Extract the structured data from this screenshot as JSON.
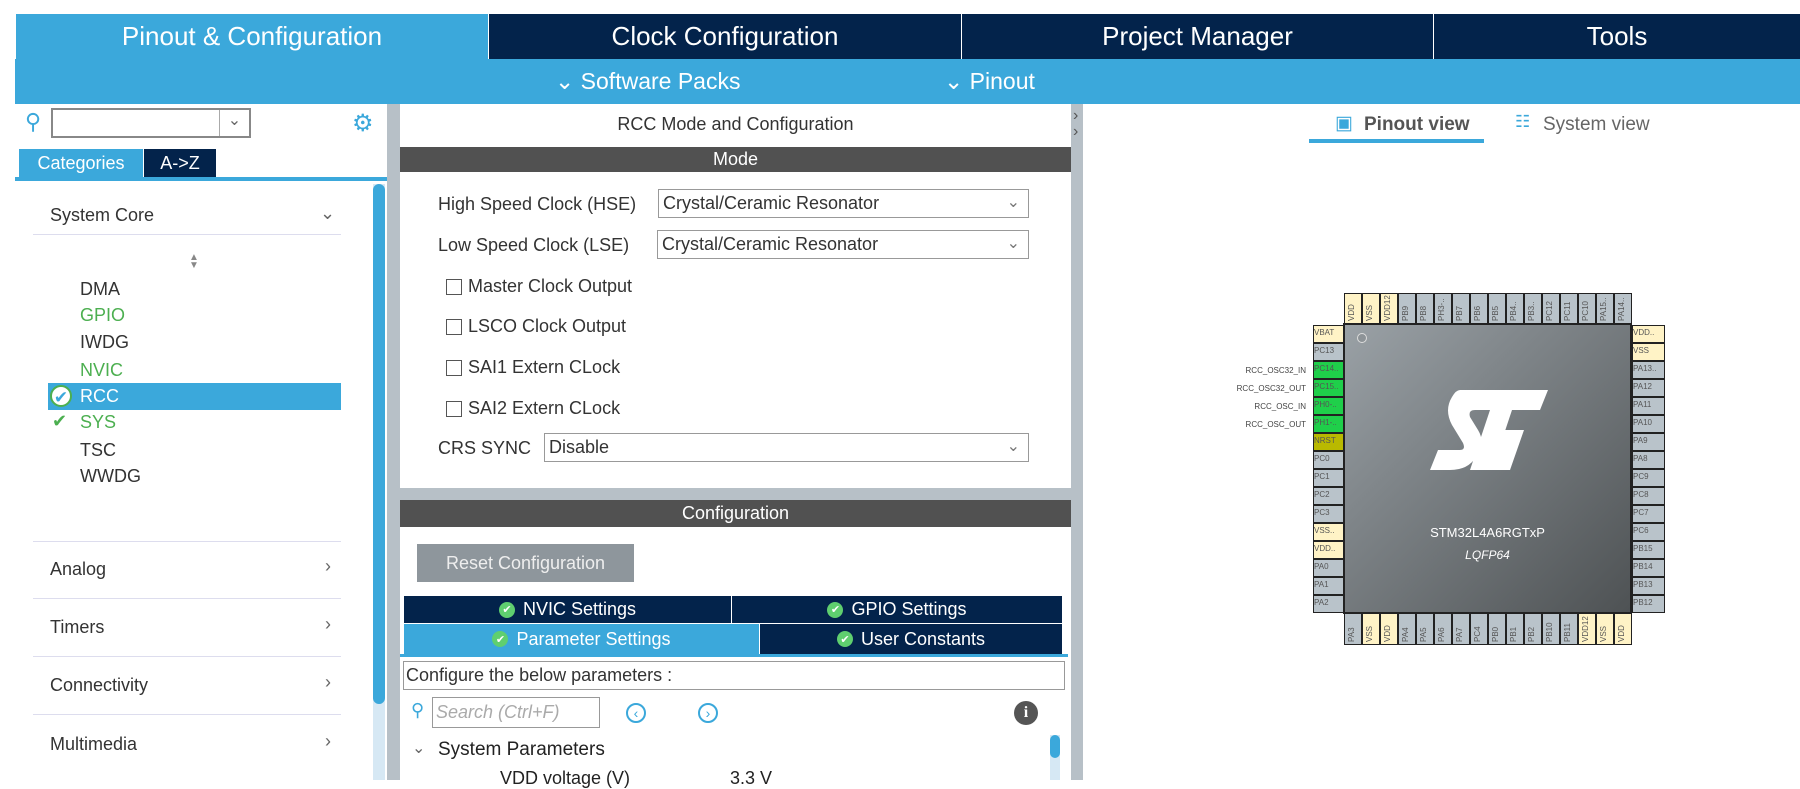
{
  "top_tabs": [
    {
      "label": "Pinout & Configuration",
      "active": true
    },
    {
      "label": "Clock Configuration"
    },
    {
      "label": "Project Manager"
    },
    {
      "label": "Tools"
    }
  ],
  "sub_menu": {
    "software_packs": "Software Packs",
    "pinout": "Pinout"
  },
  "left": {
    "search_value": "",
    "tabs": {
      "categories": "Categories",
      "az": "A->Z"
    },
    "categories": [
      {
        "label": "System Core",
        "chevron": "chevron-down"
      },
      {
        "label": "Analog"
      },
      {
        "label": "Timers"
      },
      {
        "label": "Connectivity"
      },
      {
        "label": "Multimedia"
      }
    ],
    "system_core_items": [
      {
        "label": "DMA",
        "state": "normal"
      },
      {
        "label": "GPIO",
        "state": "green"
      },
      {
        "label": "IWDG",
        "state": "normal"
      },
      {
        "label": "NVIC",
        "state": "green"
      },
      {
        "label": "RCC",
        "state": "selected-checked"
      },
      {
        "label": "SYS",
        "state": "checked"
      },
      {
        "label": "TSC",
        "state": "normal"
      },
      {
        "label": "WWDG",
        "state": "normal"
      }
    ]
  },
  "mode_panel": {
    "title": "RCC Mode and Configuration",
    "mode_header": "Mode",
    "hse_label": "High Speed Clock (HSE)",
    "hse_value": "Crystal/Ceramic Resonator",
    "lse_label": "Low Speed Clock (LSE)",
    "lse_value": "Crystal/Ceramic Resonator",
    "checkboxes": [
      "Master Clock Output",
      "LSCO Clock Output",
      "SAI1 Extern CLock",
      "SAI2 Extern CLock"
    ],
    "crs_label": "CRS SYNC",
    "crs_value": "Disable"
  },
  "config_panel": {
    "header": "Configuration",
    "reset_button": "Reset Configuration",
    "tabs": [
      "NVIC Settings",
      "GPIO Settings",
      "Parameter Settings",
      "User Constants"
    ],
    "configure_text": "Configure the below parameters :",
    "search_placeholder": "Search (Ctrl+F)",
    "group": "System Parameters",
    "param_name": "VDD voltage (V)",
    "param_value": "3.3 V"
  },
  "view_tabs": {
    "pinout": "Pinout view",
    "system": "System view"
  },
  "chip": {
    "name": "STM32L4A6RGTxP",
    "package": "LQFP64",
    "logo": "ST",
    "colors": {
      "power": "#fff3c6",
      "io": "#b9c3ca",
      "green": "#1fcf4a",
      "reset": "#b9b900"
    },
    "top_pins": [
      [
        "VDD",
        "power"
      ],
      [
        "VSS",
        "power"
      ],
      [
        "VDD12",
        "power"
      ],
      [
        "PB9",
        "io"
      ],
      [
        "PB8",
        "io"
      ],
      [
        "PH3-..",
        "io"
      ],
      [
        "PB7",
        "io"
      ],
      [
        "PB6",
        "io"
      ],
      [
        "PB5",
        "io"
      ],
      [
        "PB4..",
        "io"
      ],
      [
        "PB3..",
        "io"
      ],
      [
        "PC12",
        "io"
      ],
      [
        "PC11",
        "io"
      ],
      [
        "PC10",
        "io"
      ],
      [
        "PA15..",
        "io"
      ],
      [
        "PA14..",
        "io"
      ]
    ],
    "left_pins": [
      [
        "VBAT",
        "power"
      ],
      [
        "PC13",
        "io"
      ],
      [
        "PC14..",
        "green"
      ],
      [
        "PC15..",
        "green"
      ],
      [
        "PH0-..",
        "green"
      ],
      [
        "PH1-..",
        "green"
      ],
      [
        "NRST",
        "reset"
      ],
      [
        "PC0",
        "io"
      ],
      [
        "PC1",
        "io"
      ],
      [
        "PC2",
        "io"
      ],
      [
        "PC3",
        "io"
      ],
      [
        "VSS..",
        "power"
      ],
      [
        "VDD..",
        "power"
      ],
      [
        "PA0",
        "io"
      ],
      [
        "PA1",
        "io"
      ],
      [
        "PA2",
        "io"
      ]
    ],
    "right_pins": [
      [
        "VDD..",
        "power"
      ],
      [
        "VSS",
        "power"
      ],
      [
        "PA13..",
        "io"
      ],
      [
        "PA12",
        "io"
      ],
      [
        "PA11",
        "io"
      ],
      [
        "PA10",
        "io"
      ],
      [
        "PA9",
        "io"
      ],
      [
        "PA8",
        "io"
      ],
      [
        "PC9",
        "io"
      ],
      [
        "PC8",
        "io"
      ],
      [
        "PC7",
        "io"
      ],
      [
        "PC6",
        "io"
      ],
      [
        "PB15",
        "io"
      ],
      [
        "PB14",
        "io"
      ],
      [
        "PB13",
        "io"
      ],
      [
        "PB12",
        "io"
      ]
    ],
    "bottom_pins": [
      [
        "PA3",
        "io"
      ],
      [
        "VSS",
        "power"
      ],
      [
        "VDD",
        "power"
      ],
      [
        "PA4",
        "io"
      ],
      [
        "PA5",
        "io"
      ],
      [
        "PA6",
        "io"
      ],
      [
        "PA7",
        "io"
      ],
      [
        "PC4",
        "io"
      ],
      [
        "PB0",
        "io"
      ],
      [
        "PB1",
        "io"
      ],
      [
        "PB2",
        "io"
      ],
      [
        "PB10",
        "io"
      ],
      [
        "PB11",
        "io"
      ],
      [
        "VDD12",
        "power"
      ],
      [
        "VSS",
        "power"
      ],
      [
        "VDD",
        "power"
      ]
    ],
    "signal_labels": [
      "RCC_OSC32_IN",
      "RCC_OSC32_OUT",
      "RCC_OSC_IN",
      "RCC_OSC_OUT"
    ]
  }
}
